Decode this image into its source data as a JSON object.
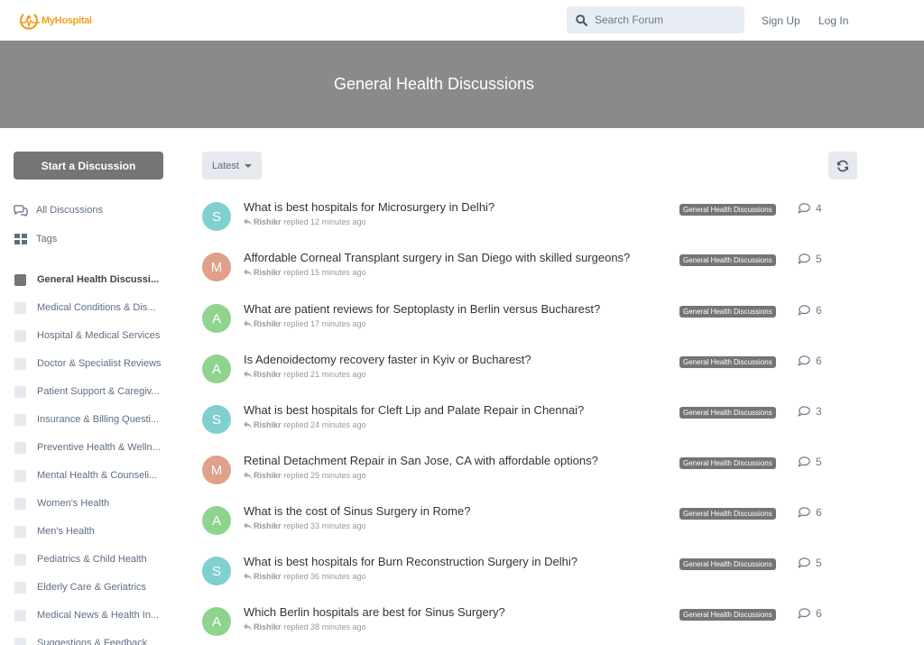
{
  "header": {
    "logo_text": "MyHospital",
    "search_placeholder": "Search Forum",
    "signup_label": "Sign Up",
    "login_label": "Log In"
  },
  "hero": {
    "title": "General Health Discussions"
  },
  "sidebar": {
    "start_label": "Start a Discussion",
    "nav": [
      {
        "label": "All Discussions",
        "icon": "discussions-icon"
      },
      {
        "label": "Tags",
        "icon": "tags-grid-icon"
      }
    ],
    "tags": [
      {
        "label": "General Health Discussi...",
        "active": true
      },
      {
        "label": "Medical Conditions & Dis..."
      },
      {
        "label": "Hospital & Medical Services"
      },
      {
        "label": "Doctor & Specialist Reviews"
      },
      {
        "label": "Patient Support & Caregiv..."
      },
      {
        "label": "Insurance & Billing Questi..."
      },
      {
        "label": "Preventive Health & Welln..."
      },
      {
        "label": "Mental Health & Counseli..."
      },
      {
        "label": "Women's Health"
      },
      {
        "label": "Men's Health"
      },
      {
        "label": "Pediatrics & Child Health"
      },
      {
        "label": "Elderly Care & Geriatrics"
      },
      {
        "label": "Medical News & Health In..."
      },
      {
        "label": "Suggestions & Feedback"
      }
    ]
  },
  "toolbar": {
    "sort_label": "Latest"
  },
  "colors": {
    "teal": "#7fd0cf",
    "salmon": "#e0a08a",
    "green": "#8fd38f",
    "badge": "#757575"
  },
  "discussions": [
    {
      "initial": "S",
      "color": "#7fd0cf",
      "title": "What is best hospitals for Microsurgery in Delhi?",
      "user": "Rishikr",
      "time": "replied 12 minutes ago",
      "tag": "General Health Discussions",
      "replies": "4"
    },
    {
      "initial": "M",
      "color": "#e0a08a",
      "title": "Affordable Corneal Transplant surgery in San Diego with skilled surgeons?",
      "user": "Rishikr",
      "time": "replied 15 minutes ago",
      "tag": "General Health Discussions",
      "replies": "5"
    },
    {
      "initial": "A",
      "color": "#8fd38f",
      "title": "What are patient reviews for Septoplasty in Berlin versus Bucharest?",
      "user": "Rishikr",
      "time": "replied 17 minutes ago",
      "tag": "General Health Discussions",
      "replies": "6"
    },
    {
      "initial": "A",
      "color": "#8fd38f",
      "title": "Is Adenoidectomy recovery faster in Kyiv or Bucharest?",
      "user": "Rishikr",
      "time": "replied 21 minutes ago",
      "tag": "General Health Discussions",
      "replies": "6"
    },
    {
      "initial": "S",
      "color": "#7fd0cf",
      "title": "What is best hospitals for Cleft Lip and Palate Repair in Chennai?",
      "user": "Rishikr",
      "time": "replied 24 minutes ago",
      "tag": "General Health Discussions",
      "replies": "3"
    },
    {
      "initial": "M",
      "color": "#e0a08a",
      "title": "Retinal Detachment Repair in San Jose, CA with affordable options?",
      "user": "Rishikr",
      "time": "replied 29 minutes ago",
      "tag": "General Health Discussions",
      "replies": "5"
    },
    {
      "initial": "A",
      "color": "#8fd38f",
      "title": "What is the cost of Sinus Surgery in Rome?",
      "user": "Rishikr",
      "time": "replied 33 minutes ago",
      "tag": "General Health Discussions",
      "replies": "6"
    },
    {
      "initial": "S",
      "color": "#7fd0cf",
      "title": "What is best hospitals for Burn Reconstruction Surgery in Delhi?",
      "user": "Rishikr",
      "time": "replied 36 minutes ago",
      "tag": "General Health Discussions",
      "replies": "5"
    },
    {
      "initial": "A",
      "color": "#8fd38f",
      "title": "Which Berlin hospitals are best for Sinus Surgery?",
      "user": "Rishikr",
      "time": "replied 38 minutes ago",
      "tag": "General Health Discussions",
      "replies": "6"
    }
  ]
}
